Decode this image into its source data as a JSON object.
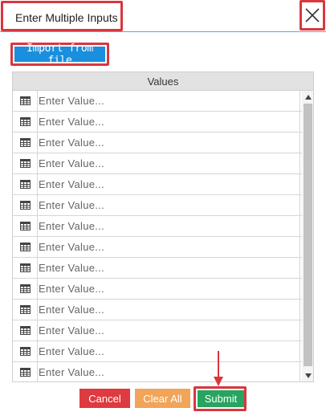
{
  "dialog": {
    "title": "Enter Multiple Inputs"
  },
  "toolbar": {
    "import_label": "Import from file"
  },
  "grid": {
    "header": "Values",
    "rows": [
      {
        "placeholder": "Enter Value..."
      },
      {
        "placeholder": "Enter Value..."
      },
      {
        "placeholder": "Enter Value..."
      },
      {
        "placeholder": "Enter Value..."
      },
      {
        "placeholder": "Enter Value..."
      },
      {
        "placeholder": "Enter Value..."
      },
      {
        "placeholder": "Enter Value..."
      },
      {
        "placeholder": "Enter Value..."
      },
      {
        "placeholder": "Enter Value..."
      },
      {
        "placeholder": "Enter Value..."
      },
      {
        "placeholder": "Enter Value..."
      },
      {
        "placeholder": "Enter Value..."
      },
      {
        "placeholder": "Enter Value..."
      },
      {
        "placeholder": "Enter Value..."
      }
    ],
    "row_icon": "table-grid-icon"
  },
  "footer": {
    "cancel_label": "Cancel",
    "clear_label": "Clear All",
    "submit_label": "Submit"
  },
  "colors": {
    "highlight_red": "#d9363e",
    "import_blue": "#1a8fdd",
    "cancel_red": "#de3a3f",
    "clear_orange": "#f0a55a",
    "submit_green": "#27a45f",
    "title_underline": "#5aa9dc"
  },
  "icons": {
    "close": "close-icon",
    "scroll_up": "arrow-up-icon",
    "scroll_down": "arrow-down-icon",
    "annotation": "red-arrow-annotation"
  }
}
